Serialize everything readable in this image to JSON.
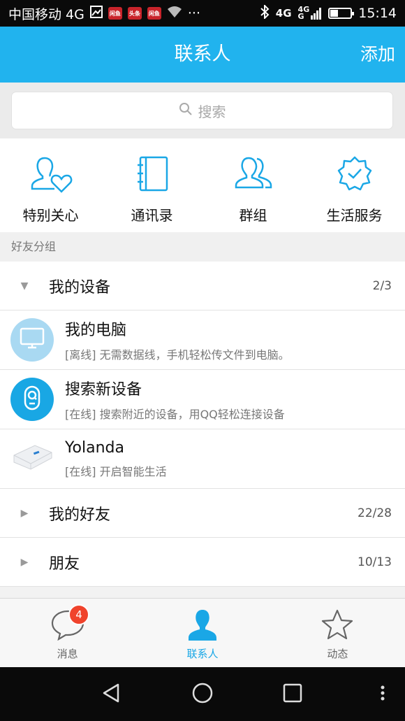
{
  "status_bar": {
    "carrier": "中国移动 4G",
    "app_badges": [
      "闲鱼",
      "头条",
      "闲鱼"
    ],
    "ellipsis": "···",
    "network": "4G",
    "network_small_top": "4G",
    "network_small_bottom": "G",
    "battery_level": 0.35,
    "time": "15:14"
  },
  "header": {
    "title": "联系人",
    "action": "添加"
  },
  "search": {
    "placeholder": "搜索"
  },
  "shortcuts": [
    {
      "label": "特别关心",
      "icon": "special-care-icon"
    },
    {
      "label": "通讯录",
      "icon": "address-book-icon"
    },
    {
      "label": "群组",
      "icon": "group-icon"
    },
    {
      "label": "生活服务",
      "icon": "life-service-icon"
    }
  ],
  "section_label": "好友分组",
  "groups": [
    {
      "name": "我的设备",
      "count": "2/3",
      "expanded": true
    },
    {
      "name": "我的好友",
      "count": "22/28",
      "expanded": false
    },
    {
      "name": "朋友",
      "count": "10/13",
      "expanded": false
    }
  ],
  "devices": [
    {
      "name": "我的电脑",
      "desc": "[离线] 无需数据线，手机轻松传文件到电脑。",
      "icon": "computer-icon"
    },
    {
      "name": "搜索新设备",
      "desc": "[在线] 搜索附近的设备，用QQ轻松连接设备",
      "icon": "device-search-icon"
    },
    {
      "name": "Yolanda",
      "desc": "[在线] 开启智能生活",
      "icon": "smart-scale-icon"
    }
  ],
  "tabs": [
    {
      "label": "消息",
      "icon": "message-icon",
      "badge": "4",
      "active": false
    },
    {
      "label": "联系人",
      "icon": "contact-icon",
      "active": true
    },
    {
      "label": "动态",
      "icon": "star-icon",
      "active": false
    }
  ],
  "colors": {
    "primary": "#21b3ee",
    "active_tab": "#1aa7e6",
    "badge": "#f0432c"
  }
}
